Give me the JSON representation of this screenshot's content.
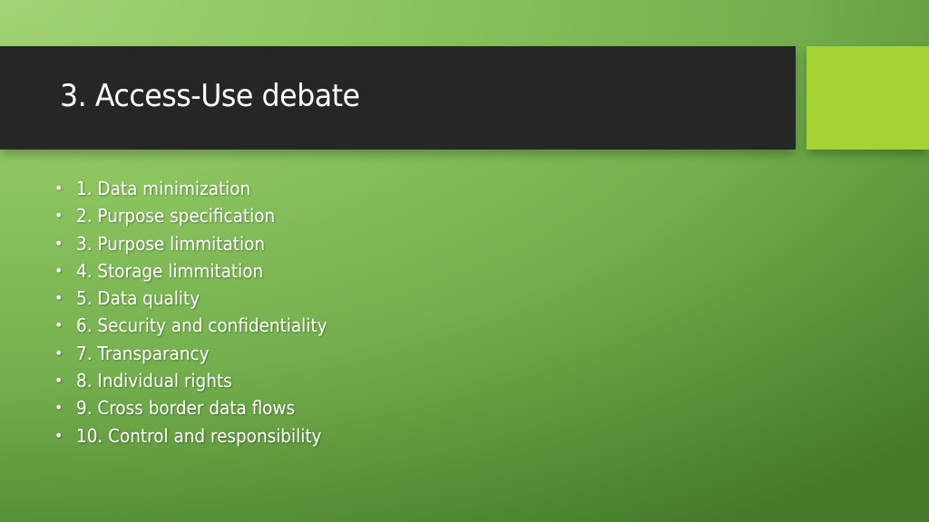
{
  "slide": {
    "title": "3. Access-Use debate",
    "bullet_glyph": "•",
    "items": [
      {
        "label": "1. Data minimization"
      },
      {
        "label": "2. Purpose specification"
      },
      {
        "label": "3. Purpose limmitation"
      },
      {
        "label": "4. Storage limmitation"
      },
      {
        "label": "5. Data quality"
      },
      {
        "label": "6. Security and confidentiality"
      },
      {
        "label": "7. Transparancy"
      },
      {
        "label": "8. Individual rights"
      },
      {
        "label": "9. Cross border data flows"
      },
      {
        "label": "10. Control and responsibility"
      }
    ]
  },
  "colors": {
    "banner": "#262626",
    "accent": "#a5d333",
    "background_light": "#a3d476",
    "background_dark": "#467a2a",
    "text": "#ffffff"
  }
}
